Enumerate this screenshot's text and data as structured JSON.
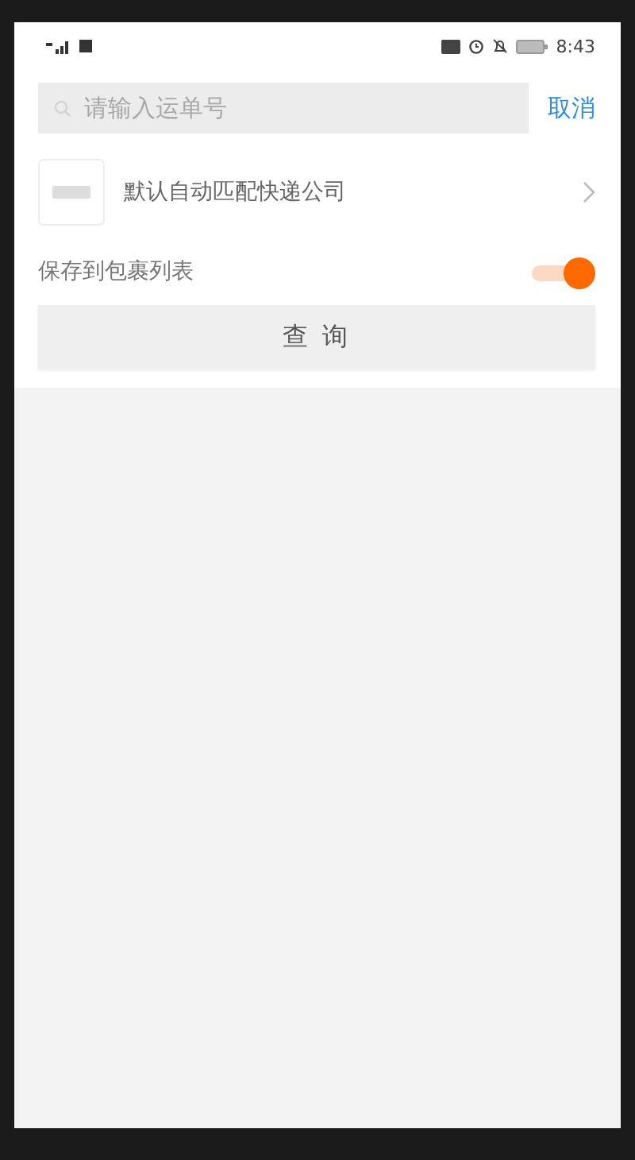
{
  "status_bar": {
    "time": "8:43"
  },
  "search": {
    "placeholder": "请输入运单号",
    "cancel": "取消"
  },
  "company": {
    "label": "默认自动匹配快递公司"
  },
  "save_toggle": {
    "label": "保存到包裹列表",
    "on": true
  },
  "query_button": "查 询"
}
